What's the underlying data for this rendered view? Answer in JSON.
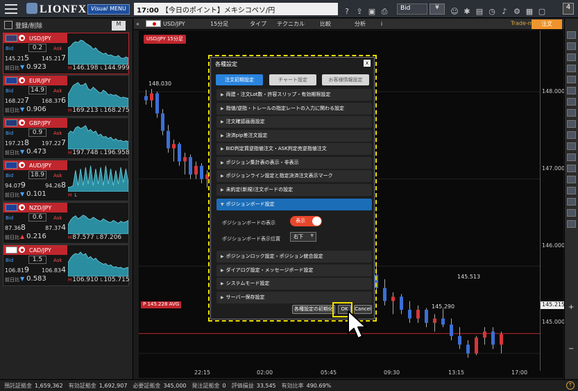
{
  "topbar": {
    "logo": "LIONFX",
    "visual_menu_prefix": "Visual",
    "visual_menu_label": "MENU",
    "ticker_time": "17:00",
    "ticker_text": "【今日のポイント】メキシコペソ/円",
    "bid_select": "Bid",
    "yen_button": "¥",
    "page_badge": "4"
  },
  "leftpanel": {
    "register_label": "登録/削除",
    "m_button": "M",
    "bid_label": "Bid",
    "ask_label": "Ask",
    "change_label": "前日比",
    "high_prefix": "H",
    "low_prefix": "L",
    "cards": [
      {
        "pair": "USD/JPY",
        "spread": "0.2",
        "bid_main": "145.21",
        "bid_last": "5",
        "ask_main": "145.21",
        "ask_last": "7",
        "dir": "down",
        "change": "0.923",
        "high": "146.198",
        "low": "144.999",
        "flag": "#3c3b6e",
        "spark": [
          0.55,
          0.6,
          0.7,
          0.75,
          0.72,
          0.8,
          0.78,
          0.7,
          0.65,
          0.6,
          0.5,
          0.55,
          0.45,
          0.4,
          0.35,
          0.38,
          0.3,
          0.32,
          0.28,
          0.25,
          0.3,
          0.22,
          0.2,
          0.25,
          0.22
        ]
      },
      {
        "pair": "EUR/JPY",
        "spread": "14.9",
        "bid_main": "168.22",
        "bid_last": "7",
        "ask_main": "168.37",
        "ask_last": "6",
        "dir": "down",
        "change": "0.906",
        "high": "169.213",
        "low": "168.275",
        "flag": "#1f3f99",
        "spark": [
          0.4,
          0.55,
          0.7,
          0.75,
          0.8,
          0.7,
          0.72,
          0.78,
          0.6,
          0.55,
          0.65,
          0.58,
          0.5,
          0.45,
          0.55,
          0.5,
          0.4,
          0.42,
          0.38,
          0.4,
          0.35,
          0.3,
          0.32,
          0.3,
          0.28
        ]
      },
      {
        "pair": "GBP/JPY",
        "spread": "0.9",
        "bid_main": "197.21",
        "bid_last": "8",
        "ask_main": "197.22",
        "ask_last": "7",
        "dir": "down",
        "change": "0.473",
        "high": "197.748",
        "low": "196.958",
        "flag": "#233a7a",
        "spark": [
          0.5,
          0.6,
          0.55,
          0.7,
          0.75,
          0.68,
          0.72,
          0.78,
          0.6,
          0.65,
          0.55,
          0.6,
          0.45,
          0.5,
          0.4,
          0.42,
          0.35,
          0.4,
          0.3,
          0.35,
          0.28,
          0.3,
          0.25,
          0.28,
          0.26
        ]
      },
      {
        "pair": "AUD/JPY",
        "spread": "18.9",
        "bid_main": "94.07",
        "bid_last": "9",
        "ask_main": "94.26",
        "ask_last": "8",
        "dir": "down",
        "change": "0.101",
        "high": "",
        "low": "",
        "flag": "#1f3f99",
        "spark": [
          0.15,
          0.15,
          0.2,
          0.7,
          0.2,
          0.75,
          0.2,
          0.8,
          0.25,
          0.85,
          0.2,
          0.75,
          0.25,
          0.8,
          0.2,
          0.85,
          0.25,
          0.75,
          0.2,
          0.7,
          0.25,
          0.8,
          0.3,
          0.75,
          0.3
        ]
      },
      {
        "pair": "NZD/JPY",
        "spread": "0.6",
        "bid_main": "87.36",
        "bid_last": "8",
        "ask_main": "87.37",
        "ask_last": "4",
        "dir": "up",
        "change": "0.216",
        "high": "87.577",
        "low": "87.206",
        "flag": "#1f3f99",
        "spark": [
          0.3,
          0.45,
          0.55,
          0.6,
          0.5,
          0.55,
          0.62,
          0.58,
          0.5,
          0.48,
          0.55,
          0.5,
          0.45,
          0.42,
          0.5,
          0.45,
          0.4,
          0.38,
          0.45,
          0.4,
          0.35,
          0.42,
          0.38,
          0.4,
          0.45
        ]
      },
      {
        "pair": "CAD/JPY",
        "spread": "1.5",
        "bid_main": "106.81",
        "bid_last": "9",
        "ask_main": "106.83",
        "ask_last": "4",
        "dir": "down",
        "change": "0.583",
        "high": "106.910",
        "low": "105.715",
        "flag": "#ffffff",
        "spark": [
          0.45,
          0.6,
          0.7,
          0.75,
          0.72,
          0.8,
          0.7,
          0.75,
          0.6,
          0.65,
          0.55,
          0.6,
          0.5,
          0.45,
          0.4,
          0.42,
          0.35,
          0.38,
          0.3,
          0.32,
          0.28,
          0.3,
          0.25,
          0.28,
          0.3
        ]
      }
    ]
  },
  "chart_toolbar": {
    "pair": "USD/JPY",
    "timeframe": "15分足",
    "type_label": "タイプ",
    "technical_label": "テクニカル",
    "compare_label": "比較",
    "analysis_label": "分析",
    "info_label": "i",
    "order_button": "注文",
    "trade_mode": "Trade-mode"
  },
  "chart": {
    "label": "USD/JPY 15分足",
    "y_ticks": [
      "148.000",
      "147.000",
      "146.000",
      "145.000"
    ],
    "x_ticks": [
      "22:15",
      "02:00",
      "05:45",
      "09:30",
      "13:15",
      "17:00"
    ],
    "current_price": "145.215",
    "avg_tag": "P 145.228 AVG",
    "annotations": [
      {
        "text": "148.030"
      },
      {
        "text": "145.513"
      },
      {
        "text": "145.290"
      }
    ]
  },
  "dialog": {
    "title": "各種設定",
    "close": "x",
    "tabs": [
      "注文初期設定",
      "チャート設定",
      "お客様情報設定"
    ],
    "rows_top": [
      "両建・注文Lot数・許容スリップ・有効期限設定",
      "指値/逆指・トレールの指定レートの入力に関わる設定",
      "注文確認画面設定",
      "決済pip差注文設定",
      "BID判定買逆指値注文・ASK判定売逆指値注文",
      "ポジション集計表の表示・非表示",
      "ポジションライン設定と指定決済注文表示マーク",
      "未約定(新規)注文ボードの設定"
    ],
    "open_row": "ポジションボード設定",
    "position_board_show_label": "ポジションボードの表示",
    "position_board_show_value": "表示",
    "position_board_position_label": "ポジションボード表示位置",
    "position_board_position_value": "右下",
    "rows_bottom": [
      "ポジションロック設定・ポジション統合設定",
      "ダイアログ設定・メッセージボード設定",
      "システムモード設定",
      "サーバー保存設定"
    ],
    "init_button": "各種設定の初期化",
    "ok_button": "OK",
    "cancel_button": "Cancel"
  },
  "statusbar": {
    "items": [
      {
        "label": "預託証拠金",
        "value": "1,659,362"
      },
      {
        "label": "有効証拠金",
        "value": "1,692,907"
      },
      {
        "label": "必要証拠金",
        "value": "345,000"
      },
      {
        "label": "発注証拠金",
        "value": "0"
      },
      {
        "label": "評価損益",
        "value": "33,545"
      },
      {
        "label": "有効比率",
        "value": "490.69%"
      }
    ]
  },
  "chart_data": {
    "type": "candlestick",
    "title": "USD/JPY 15分足",
    "ylim": [
      144.8,
      148.7
    ],
    "x_ticks": [
      "22:15",
      "02:00",
      "05:45",
      "09:30",
      "13:15",
      "17:00"
    ],
    "candles": [
      [
        147.95,
        148.02,
        147.85,
        147.9
      ],
      [
        147.9,
        148.03,
        147.82,
        147.98
      ],
      [
        147.98,
        148.0,
        147.7,
        147.75
      ],
      [
        147.75,
        147.8,
        147.5,
        147.55
      ],
      [
        147.55,
        147.62,
        147.3,
        147.35
      ],
      [
        147.35,
        147.45,
        147.2,
        147.4
      ],
      [
        147.4,
        147.42,
        147.15,
        147.2
      ],
      [
        147.2,
        147.3,
        147.05,
        147.25
      ],
      [
        147.25,
        147.28,
        147.0,
        147.05
      ],
      [
        147.05,
        147.2,
        147.0,
        147.15
      ],
      [
        147.15,
        147.18,
        146.95,
        147.0
      ],
      [
        147.0,
        147.1,
        146.9,
        147.05
      ],
      [
        145.9,
        146.0,
        145.7,
        145.75
      ],
      [
        145.75,
        145.85,
        145.55,
        145.6
      ],
      [
        145.6,
        145.7,
        145.45,
        145.65
      ],
      [
        145.65,
        145.68,
        145.45,
        145.5
      ],
      [
        145.5,
        145.6,
        145.35,
        145.4
      ],
      [
        145.4,
        145.55,
        145.35,
        145.5
      ],
      [
        145.5,
        145.52,
        145.3,
        145.35
      ],
      [
        145.35,
        145.45,
        145.25,
        145.4
      ],
      [
        145.4,
        145.51,
        145.3,
        145.33
      ],
      [
        145.33,
        145.4,
        145.15,
        145.2
      ],
      [
        145.2,
        145.3,
        145.05,
        145.1
      ],
      [
        145.1,
        145.15,
        144.95,
        145.0
      ],
      [
        145.0,
        145.2,
        144.98,
        145.18
      ],
      [
        145.18,
        145.3,
        145.1,
        145.25
      ],
      [
        145.25,
        145.3,
        145.05,
        145.1
      ],
      [
        145.1,
        145.25,
        145.0,
        145.22
      ]
    ]
  }
}
